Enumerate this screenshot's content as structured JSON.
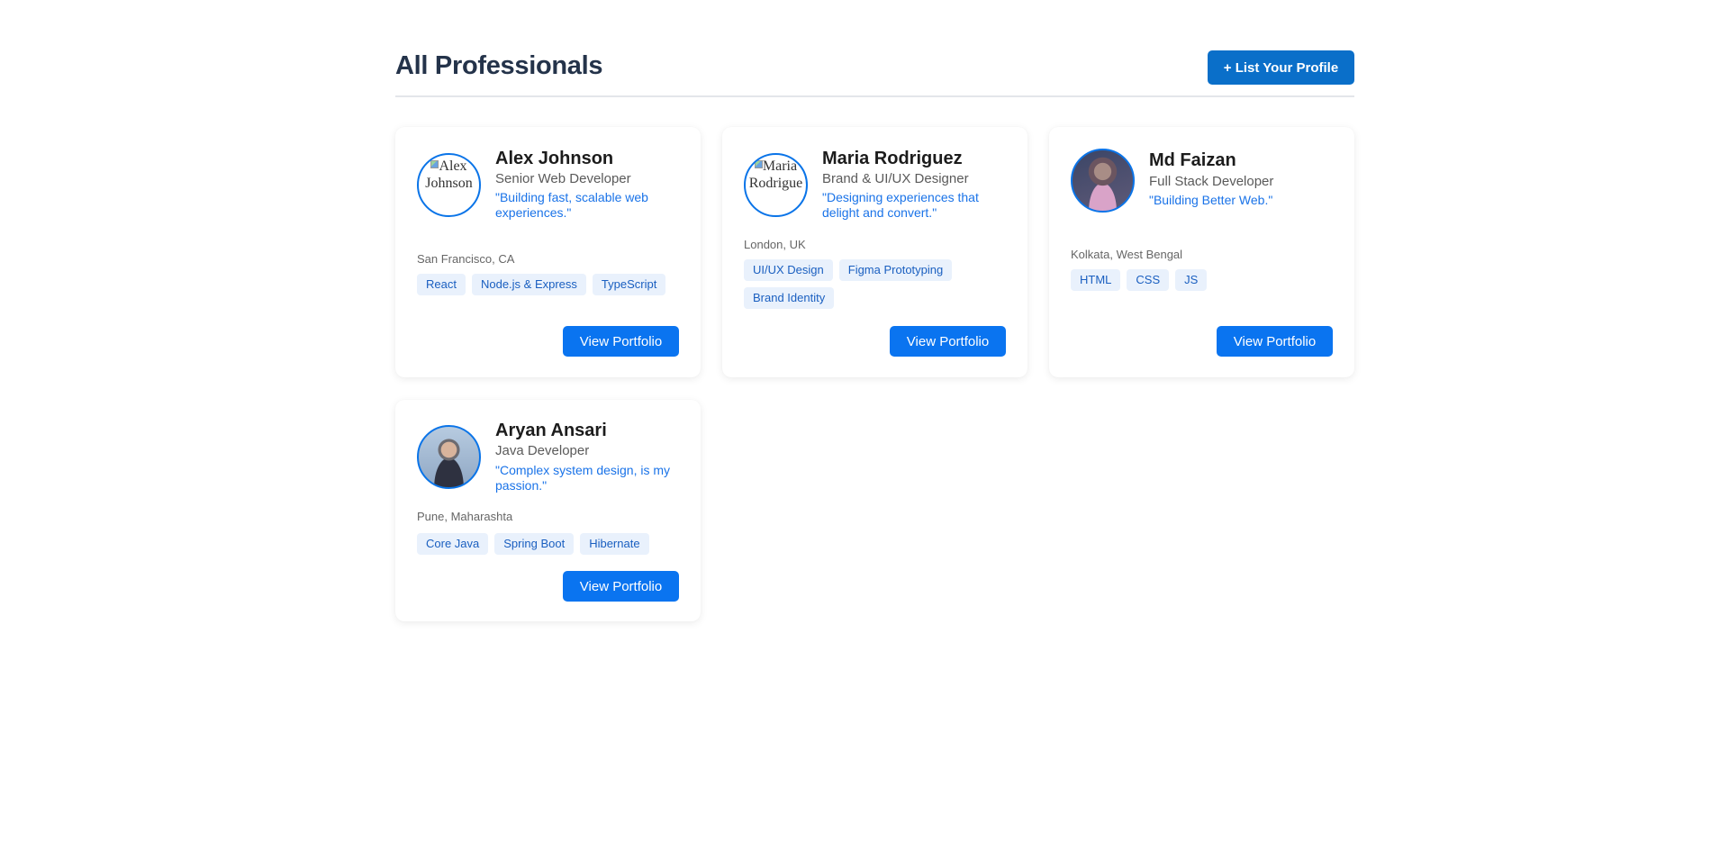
{
  "header": {
    "title": "All Professionals",
    "list_button_label": "+ List Your Profile"
  },
  "professionals": [
    {
      "name": "Alex Johnson",
      "role": "Senior Web Developer",
      "tagline": "\"Building fast, scalable web experiences.\"",
      "location": "San Francisco, CA",
      "avatar_alt": "Alex Johnson",
      "skills": [
        "React",
        "Node.js & Express",
        "TypeScript"
      ],
      "button_label": "View Portfolio"
    },
    {
      "name": "Maria Rodriguez",
      "role": "Brand & UI/UX Designer",
      "tagline": "\"Designing experiences that delight and convert.\"",
      "location": "London, UK",
      "avatar_alt": "Maria Rodrigue",
      "skills": [
        "UI/UX Design",
        "Figma Prototyping",
        "Brand Identity"
      ],
      "button_label": "View Portfolio"
    },
    {
      "name": "Md Faizan",
      "role": "Full Stack Developer",
      "tagline": "\"Building Better Web.\"",
      "location": "Kolkata, West Bengal",
      "skills": [
        "HTML",
        "CSS",
        "JS"
      ],
      "button_label": "View Portfolio"
    },
    {
      "name": "Aryan Ansari",
      "role": "Java Developer",
      "tagline": "\"Complex system design, is my passion.\"",
      "location": "Pune, Maharashta",
      "skills": [
        "Core Java",
        "Spring Boot",
        "Hibernate"
      ],
      "button_label": "View Portfolio"
    }
  ],
  "colors": {
    "accent": "#0a74f0",
    "title": "#24334a",
    "tagline": "#1a73e8",
    "skill_bg": "#e9f1fc"
  }
}
